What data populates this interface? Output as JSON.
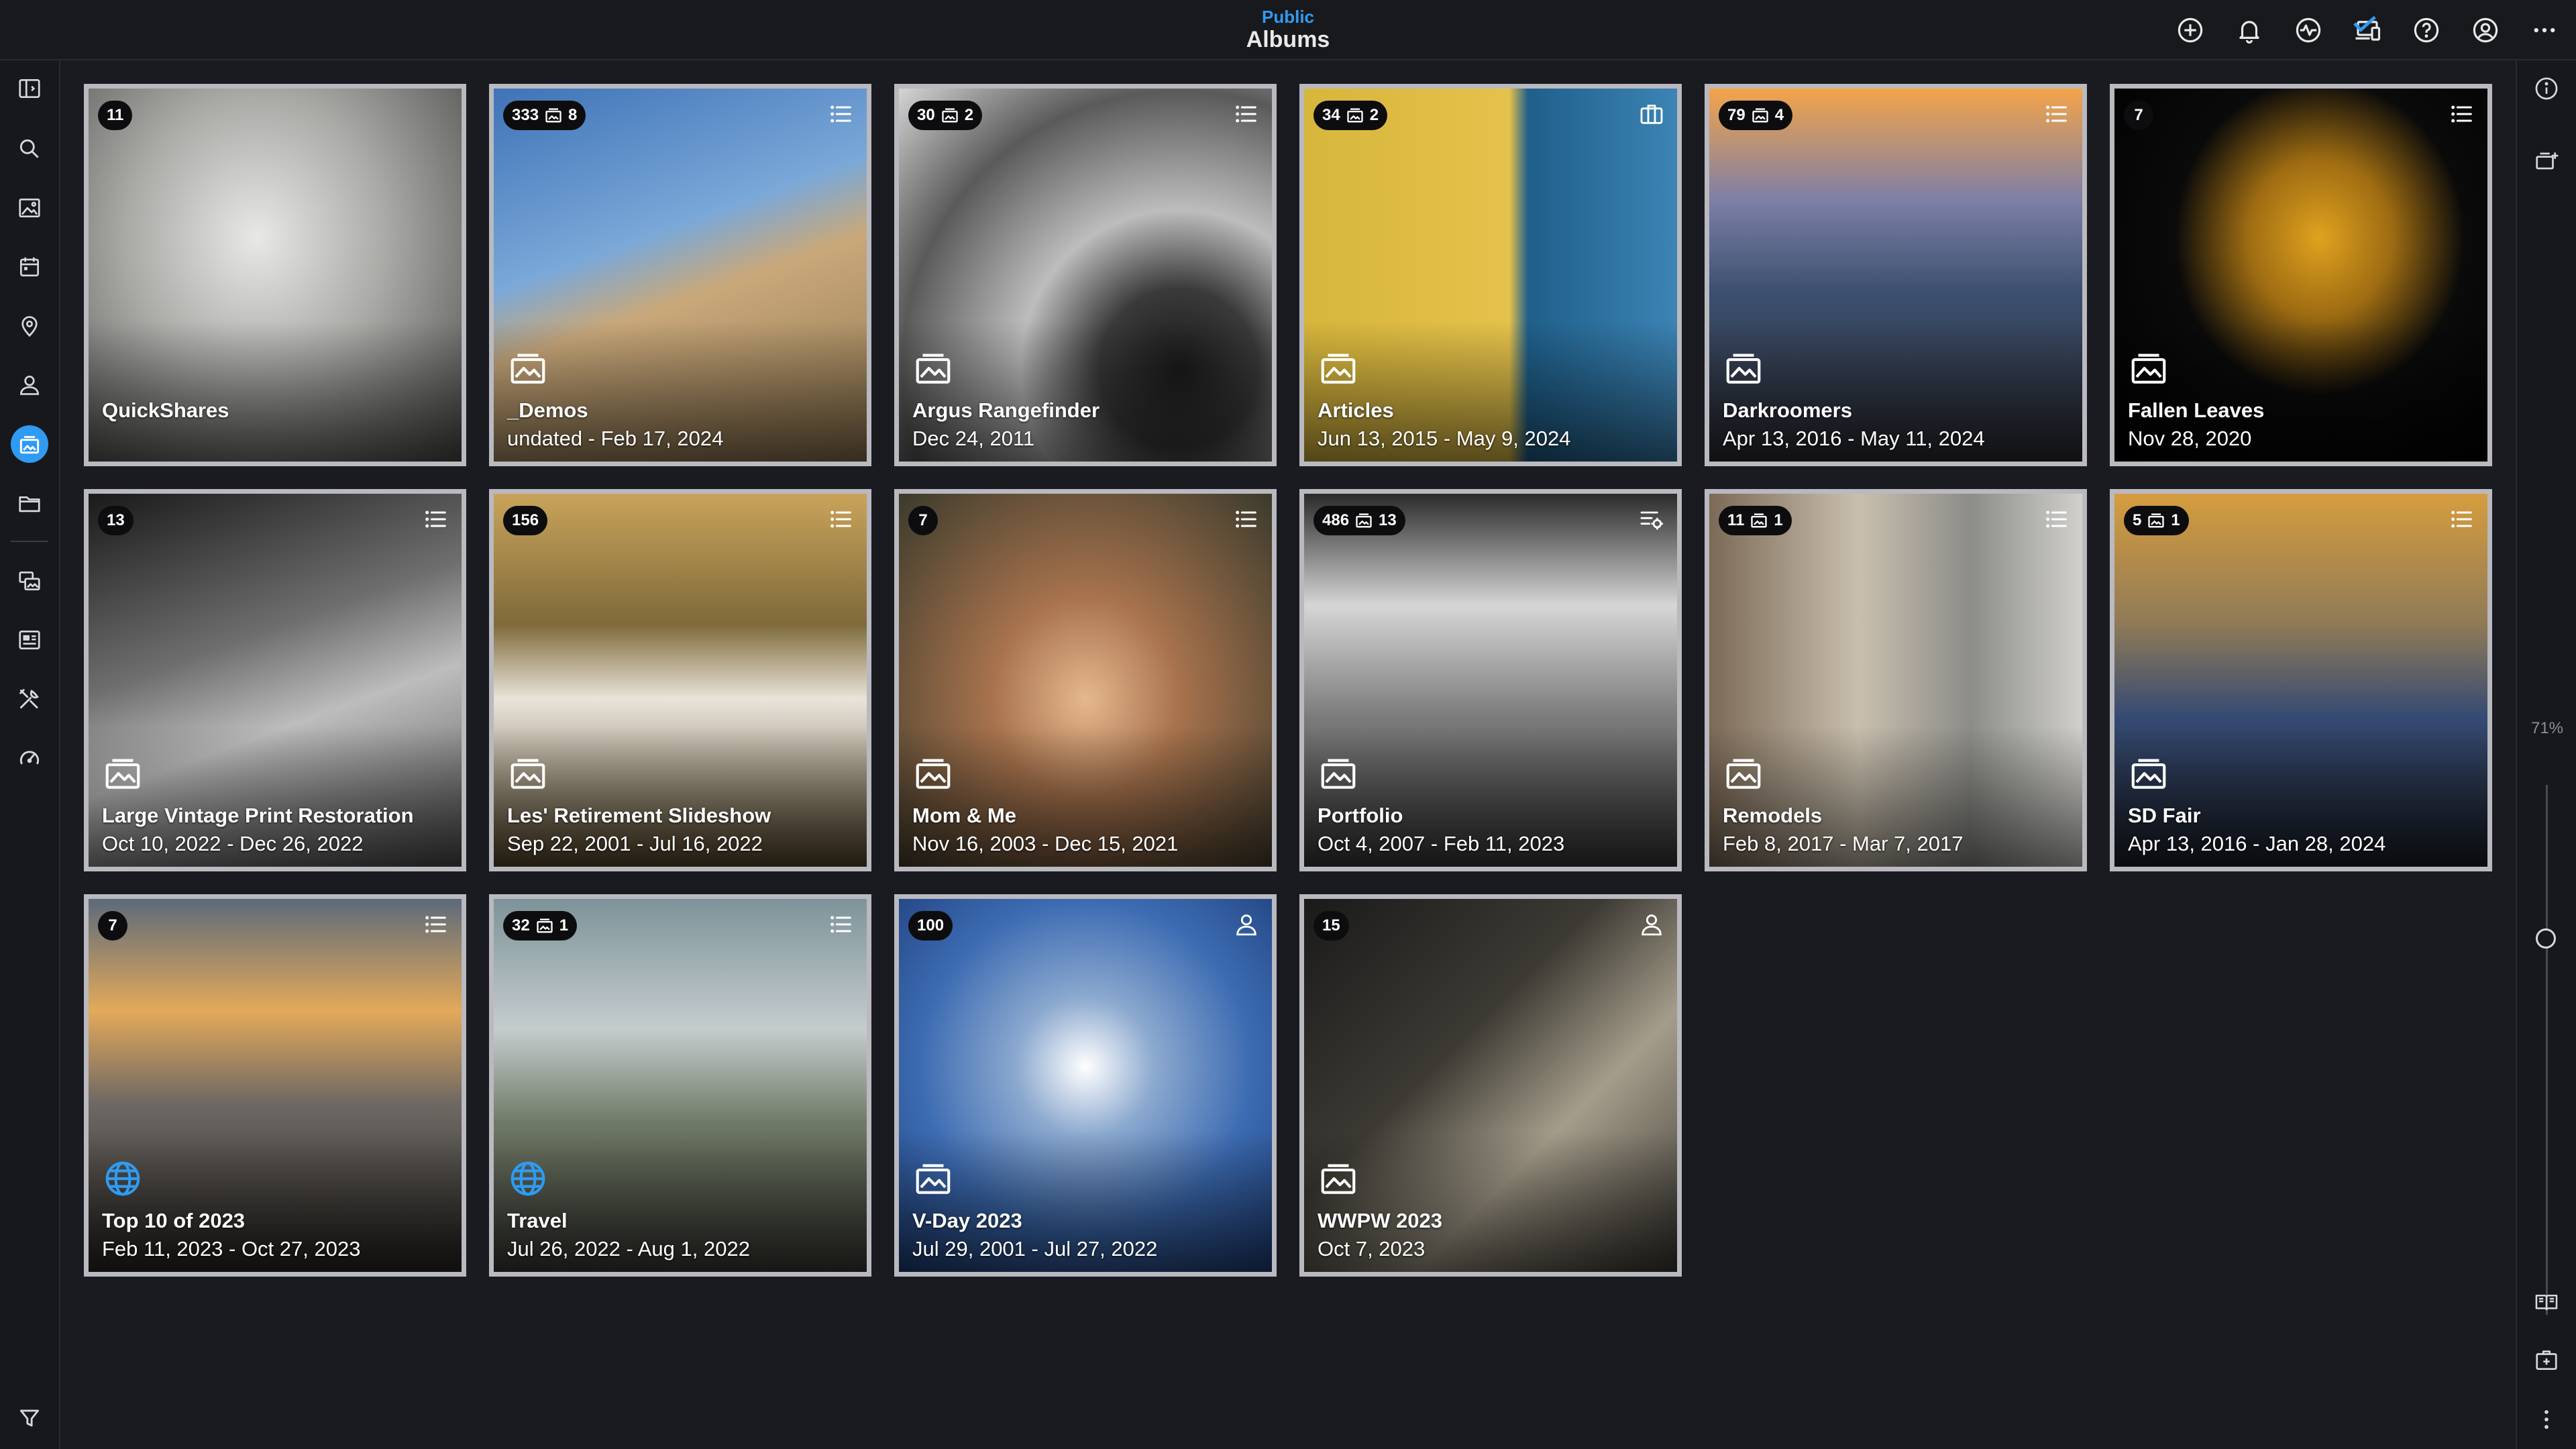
{
  "header": {
    "subtitle": "Public",
    "title": "Albums"
  },
  "header_icons": [
    "add-icon",
    "bell-icon",
    "activity-icon",
    "devices-icon",
    "help-icon",
    "account-icon",
    "more-icon"
  ],
  "left_sidebar": [
    "sidebar-toggle-icon",
    "search-icon",
    "photos-icon",
    "calendar-icon",
    "location-icon",
    "people-icon",
    "albums-icon",
    "folder-icon",
    "stacks-icon",
    "gallery-icon",
    "tools-icon",
    "dashboard-icon",
    "filter-icon"
  ],
  "right_sidebar": {
    "zoom_label": "71%",
    "zoom_level": 0.71
  },
  "colors": {
    "accent": "#2f9bf2",
    "background": "#1a1b20",
    "card_border": "#b9b9bf"
  },
  "albums": [
    {
      "name": "QuickShares",
      "date": "",
      "count": "11",
      "sub": "",
      "corner": "",
      "type": "none"
    },
    {
      "name": "_Demos",
      "date": "undated - Feb 17, 2024",
      "count": "333",
      "sub": "8",
      "corner": "list-icon",
      "type": "album-icon"
    },
    {
      "name": "Argus Rangefinder",
      "date": "Dec 24, 2011",
      "count": "30",
      "sub": "2",
      "corner": "list-icon",
      "type": "album-icon"
    },
    {
      "name": "Articles",
      "date": "Jun 13, 2015 - May 9, 2024",
      "count": "34",
      "sub": "2",
      "corner": "briefcase-icon",
      "type": "album-icon"
    },
    {
      "name": "Darkroomers",
      "date": "Apr 13, 2016 - May 11, 2024",
      "count": "79",
      "sub": "4",
      "corner": "list-icon",
      "type": "album-icon"
    },
    {
      "name": "Fallen Leaves",
      "date": "Nov 28, 2020",
      "count": "7",
      "sub": "",
      "corner": "list-icon",
      "type": "album-icon"
    },
    {
      "name": "Large Vintage Print Restoration",
      "date": "Oct 10, 2022 - Dec 26, 2022",
      "count": "13",
      "sub": "",
      "corner": "list-icon",
      "type": "album-icon"
    },
    {
      "name": "Les' Retirement Slideshow",
      "date": "Sep 22, 2001 - Jul 16, 2022",
      "count": "156",
      "sub": "",
      "corner": "list-icon",
      "type": "album-icon"
    },
    {
      "name": "Mom & Me",
      "date": "Nov 16, 2003 - Dec 15, 2021",
      "count": "7",
      "sub": "",
      "corner": "list-icon",
      "type": "album-icon"
    },
    {
      "name": "Portfolio",
      "date": "Oct 4, 2007 - Feb 11, 2023",
      "count": "486",
      "sub": "13",
      "corner": "list-settings-icon",
      "type": "album-icon"
    },
    {
      "name": "Remodels",
      "date": "Feb 8, 2017 - Mar 7, 2017",
      "count": "11",
      "sub": "1",
      "corner": "list-icon",
      "type": "album-icon"
    },
    {
      "name": "SD Fair",
      "date": "Apr 13, 2016 - Jan 28, 2024",
      "count": "5",
      "sub": "1",
      "corner": "list-icon",
      "type": "album-icon"
    },
    {
      "name": "Top 10 of 2023",
      "date": "Feb 11, 2023 - Oct 27, 2023",
      "count": "7",
      "sub": "",
      "corner": "list-icon",
      "type": "globe-icon"
    },
    {
      "name": "Travel",
      "date": "Jul 26, 2022 - Aug 1, 2022",
      "count": "32",
      "sub": "1",
      "corner": "list-icon",
      "type": "globe-icon"
    },
    {
      "name": "V-Day 2023",
      "date": "Jul 29, 2001 - Jul 27, 2022",
      "count": "100",
      "sub": "",
      "corner": "person-icon",
      "type": "album-icon"
    },
    {
      "name": "WWPW 2023",
      "date": "Oct 7, 2023",
      "count": "15",
      "sub": "",
      "corner": "person-icon",
      "type": "album-icon"
    }
  ]
}
